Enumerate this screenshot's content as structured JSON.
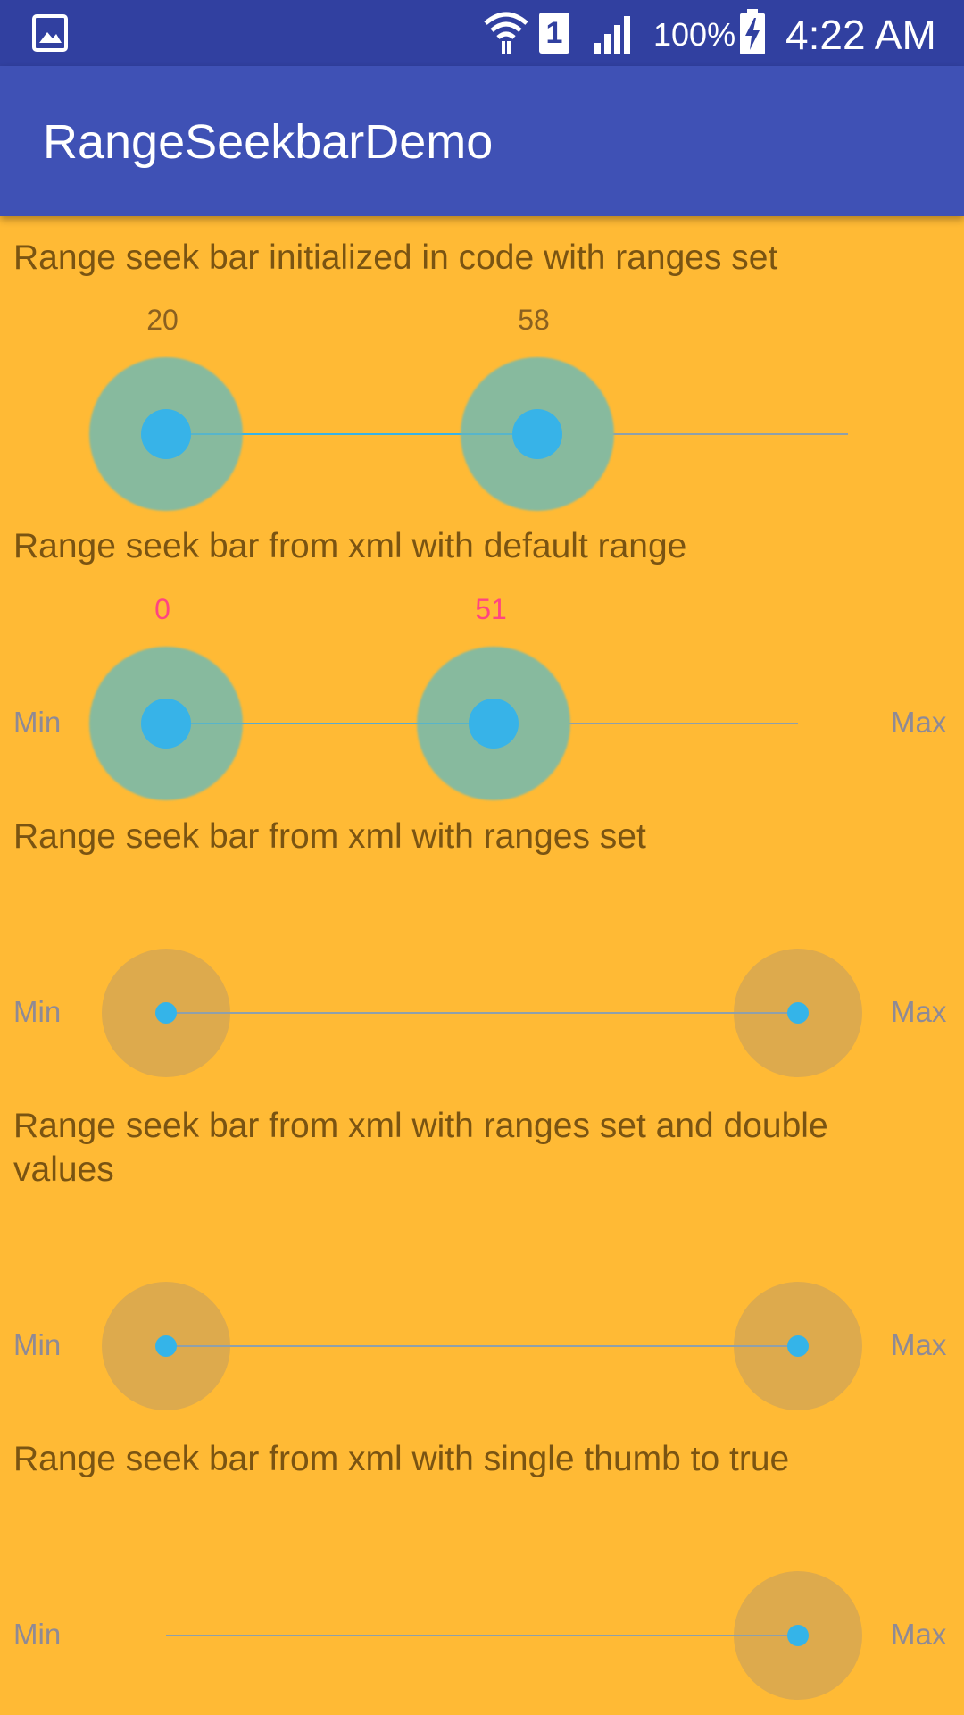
{
  "status_bar": {
    "gallery_icon": "image-icon",
    "wifi_icon": "wifi-icon",
    "sim_label": "1",
    "signal_icon": "signal-icon",
    "battery_percent": "100%",
    "battery_icon": "battery-charging-icon",
    "time": "4:22 AM"
  },
  "app_bar": {
    "title": "RangeSeekbarDemo"
  },
  "sections": [
    {
      "label": "Range seek bar initialized in code with ranges set",
      "min_value_label": "20",
      "max_value_label": "58"
    },
    {
      "label": "Range seek bar from xml with default range",
      "min_value_label": "0",
      "max_value_label": "51",
      "min_text": "Min",
      "max_text": "Max",
      "value_color": "#FF4581"
    },
    {
      "label": "Range seek bar from xml with ranges set",
      "min_text": "Min",
      "max_text": "Max"
    },
    {
      "label": "Range seek bar from xml with ranges set and double values",
      "min_text": "Min",
      "max_text": "Max"
    },
    {
      "label": "Range seek bar from xml with single thumb to true",
      "min_text": "Min",
      "max_text": "Max"
    }
  ],
  "colors": {
    "status_bar": "#3140A0",
    "app_bar": "#3F51B5",
    "background": "#FFBA35",
    "thumb": "#37B3E8",
    "thumb_halo_pressed": "#87BA9E",
    "thumb_halo": "#DDAA4D"
  }
}
